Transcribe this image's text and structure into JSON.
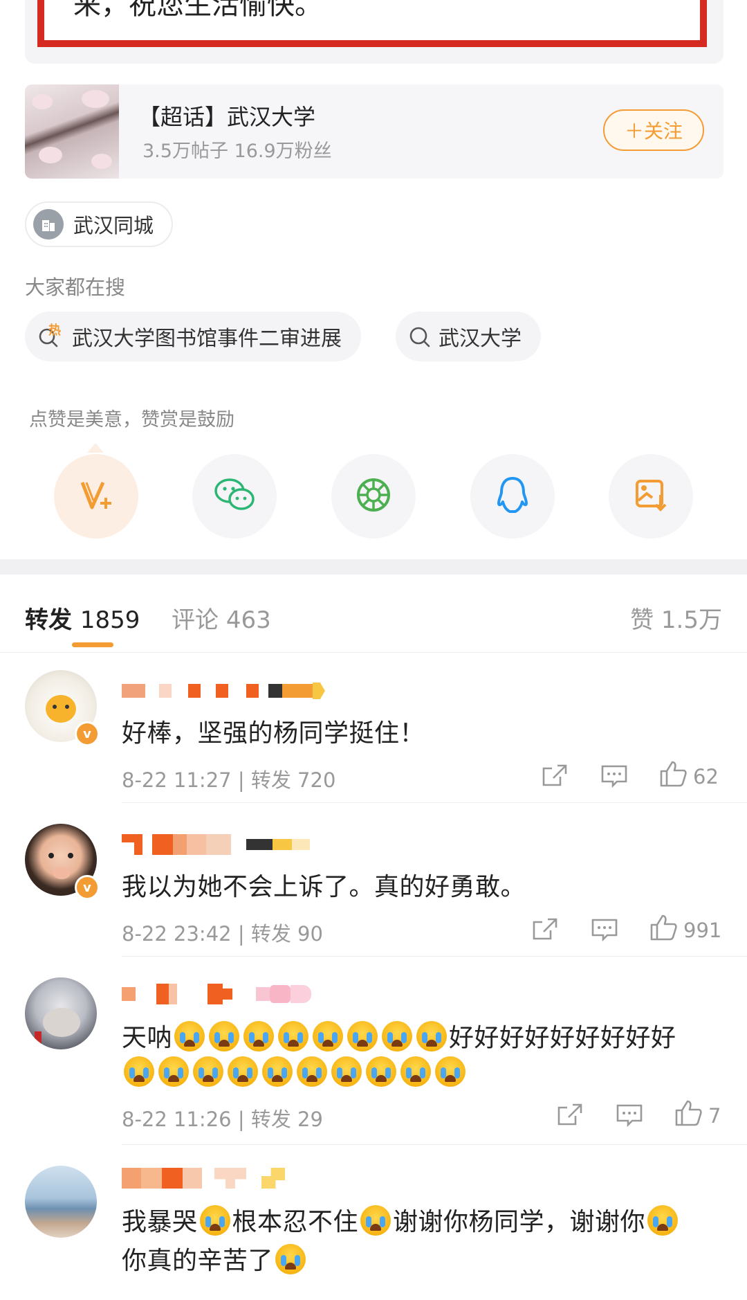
{
  "top_card": {
    "quote_text": "来，祝您生活愉快。"
  },
  "topic": {
    "title": "【超话】武汉大学",
    "stats": "3.5万帖子 16.9万粉丝",
    "follow_label": "＋关注"
  },
  "city_tag": {
    "label": "武汉同城"
  },
  "search": {
    "title": "大家都在搜",
    "chips": [
      "武汉大学图书馆事件二审进展",
      "武汉大学"
    ],
    "hot_badge": "热"
  },
  "reward": {
    "tip": "点赞是美意，赞赏是鼓励"
  },
  "share_icons": [
    "v-plus-icon",
    "wechat-icon",
    "moments-icon",
    "qq-icon",
    "save-image-icon"
  ],
  "tabs": {
    "repost_label": "转发",
    "repost_count": "1859",
    "comment_label": "评论",
    "comment_count": "463",
    "like_label": "赞",
    "like_count": "1.5万"
  },
  "comments": [
    {
      "text": "好棒，坚强的杨同学挺住！",
      "time": "8-22 11:27",
      "repost": "转发 720",
      "likes": "62"
    },
    {
      "text": "我以为她不会上诉了。真的好勇敢。",
      "time": "8-22 23:42",
      "repost": "转发 90",
      "likes": "991"
    },
    {
      "text_a": "天呐",
      "text_b": "好好好好好好好好好",
      "time": "8-22 11:26",
      "repost": "转发 29",
      "likes": "7"
    },
    {
      "line1_a": "我暴哭",
      "line1_b": "根本忍不住",
      "line1_c": "谢谢你杨同学，谢谢你",
      "line2": "你真的辛苦了"
    }
  ],
  "colors": {
    "accent": "#f39c33",
    "verified_badge": "#f39c33",
    "red_frame": "#d42a22"
  }
}
